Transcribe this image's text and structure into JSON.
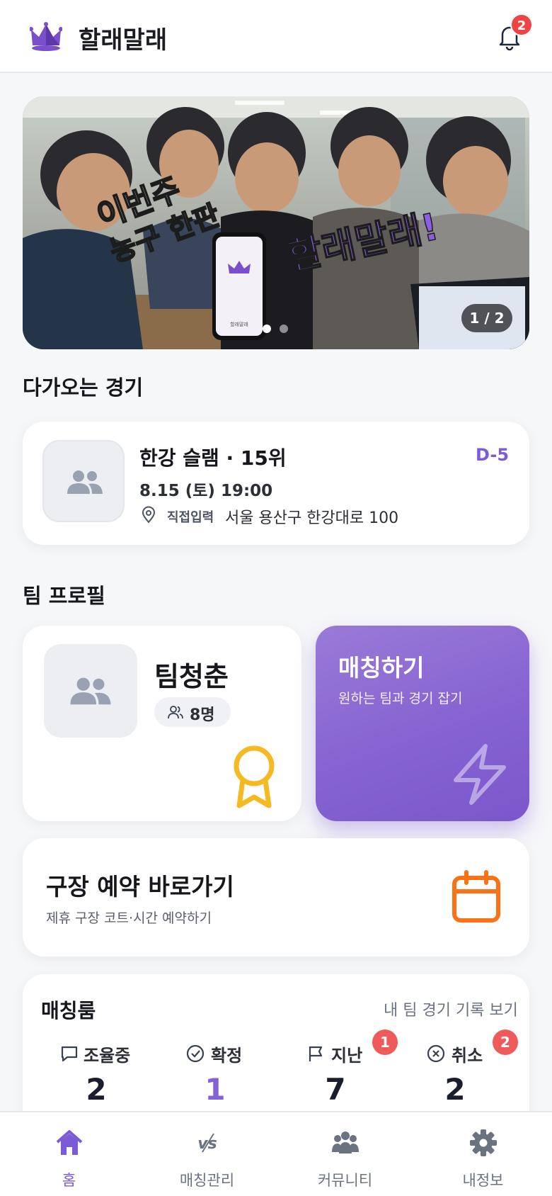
{
  "header": {
    "app_title": "할래말래",
    "notification_count": "2"
  },
  "banner": {
    "headline_left": "이번주 농구 한판",
    "headline_right": "할래말래!",
    "phone_caption": "할래말래",
    "slide_counter": "1 / 2",
    "current_slide": 1,
    "total_slides": 2
  },
  "upcoming": {
    "section_title": "다가오는 경기",
    "match_title": "한강 슬램 · 15위",
    "dday": "D-5",
    "datetime": "8.15 (토) 19:00",
    "location_tag": "직접입력",
    "location_address": "서울 용산구 한강대로 100"
  },
  "team_profile": {
    "section_title": "팀 프로필",
    "team_name": "팀청춘",
    "member_count": "8명"
  },
  "matching_button": {
    "title": "매칭하기",
    "subtitle": "원하는 팀과 경기 잡기"
  },
  "reservation": {
    "title": "구장 예약 바로가기",
    "subtitle": "제휴 구장 코트·시간 예약하기"
  },
  "matching_room": {
    "title": "매칭룸",
    "link": "내 팀 경기 기록 보기",
    "stats": [
      {
        "label": "조율중",
        "value": "2",
        "badge": ""
      },
      {
        "label": "확정",
        "value": "1",
        "badge": ""
      },
      {
        "label": "지난",
        "value": "7",
        "badge": "1"
      },
      {
        "label": "취소",
        "value": "2",
        "badge": "2"
      }
    ]
  },
  "bottom_nav": {
    "items": [
      {
        "label": "홈",
        "icon": "home-icon",
        "active": true
      },
      {
        "label": "매칭관리",
        "icon": "vs-icon",
        "active": false
      },
      {
        "label": "커뮤니티",
        "icon": "community-icon",
        "active": false
      },
      {
        "label": "내정보",
        "icon": "gear-icon",
        "active": false
      }
    ]
  },
  "colors": {
    "accent": "#7c5bd6",
    "badge": "#ef4444",
    "award": "#f5b921",
    "calendar": "#f97316",
    "value_dark": "#1a1d2e"
  }
}
